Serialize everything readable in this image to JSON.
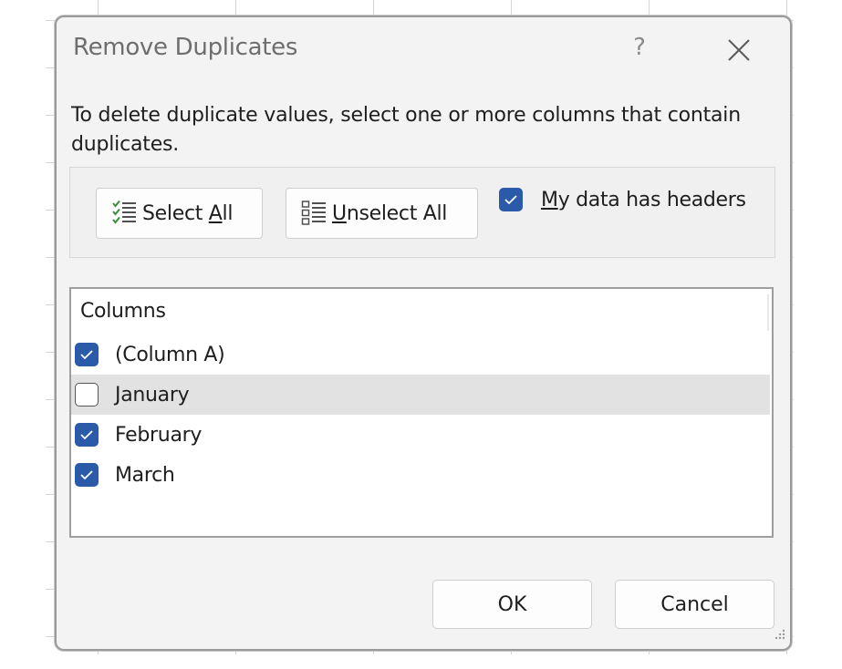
{
  "dialog": {
    "title": "Remove Duplicates",
    "help_label": "?",
    "instructions": "To delete duplicate values, select one or more columns that contain duplicates."
  },
  "toolbar": {
    "select_all_pre": "Select ",
    "select_all_ul": "A",
    "select_all_post": "ll",
    "unselect_all_ul": "U",
    "unselect_all_post": "nselect All",
    "headers_ul": "M",
    "headers_post": "y data has headers",
    "headers_checked": true
  },
  "columns": {
    "header": "Columns",
    "items": [
      {
        "label": "(Column A)",
        "checked": true
      },
      {
        "label": "January",
        "checked": false,
        "selected": true
      },
      {
        "label": "February",
        "checked": true
      },
      {
        "label": "March",
        "checked": true
      }
    ]
  },
  "footer": {
    "ok_label": "OK",
    "cancel_label": "Cancel"
  },
  "colors": {
    "accent": "#2b5aa8",
    "selection": "#e2e2e2"
  },
  "icons": [
    "select-all-icon",
    "unselect-all-icon",
    "close-icon",
    "checkmark-icon",
    "resize-grip-icon"
  ]
}
